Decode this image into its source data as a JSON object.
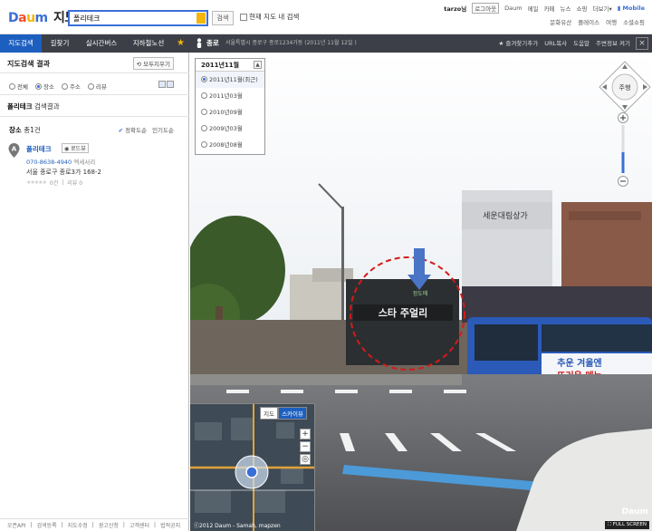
{
  "header": {
    "logo": "Daum",
    "logo_service": "지도",
    "search_value": "폴리테크",
    "search_button": "검색",
    "in_map_search": "현재 지도 내 검색",
    "user": "tarzo님",
    "logout": "로그아웃",
    "links": [
      "Daum",
      "메일",
      "카페",
      "뉴스",
      "쇼핑",
      "더보기"
    ],
    "mobile": "Mobile",
    "services": [
      "문화유산",
      "플레이스",
      "여행",
      "소셜쇼핑"
    ]
  },
  "nav": {
    "tabs": [
      "지도검색",
      "길찾기",
      "실시간버스",
      "지하철노선"
    ],
    "roadview_label": "종로",
    "roadview_address": "서울특별시 종로구 종로1234가동 (2011년 11월 12일 )",
    "right_links": [
      "즐겨찾기추가",
      "URL복사",
      "도움말",
      "주변정보 켜기"
    ],
    "close": "×"
  },
  "left": {
    "header": "지도검색 결과",
    "reset": "모두지우기",
    "filters": [
      "전체",
      "장소",
      "주소",
      "리뷰"
    ],
    "result_term": "폴리테크",
    "result_suffix": " 검색결과",
    "place_label": "장소",
    "place_count": "총1건",
    "sort_accuracy": "정확도순",
    "sort_popular": "인기도순",
    "item": {
      "marker": "A",
      "name": "폴리테크",
      "roadview": "로드뷰",
      "phone": "070-8638-4940",
      "phone_tag": "엑세서리",
      "address": "서울 종로구 종로3가 168-2",
      "rating": "0건",
      "reviews": "리뷰 0"
    },
    "footer": [
      "오픈API",
      "검색등록",
      "지도수정",
      "광고신청",
      "고객센터",
      "법적공지"
    ]
  },
  "roadview": {
    "date_header": "2011년11월",
    "dates": [
      "2011년11월(최근)",
      "2011년03월",
      "2010년09월",
      "2009년03월",
      "2008년08월"
    ],
    "compass_label": "주행",
    "store_sign": "스타 주얼리",
    "store_sign_sub": "정도매",
    "building_sign": "세운대림상가",
    "bus_ad_line1": "추운 겨울엔",
    "bus_ad_line2": "뜨거운 메뉴",
    "minimap_tabs": [
      "지도",
      "스카이뷰"
    ],
    "minimap_copyright": "ⓒ2012 Daum - Samah, mapzen",
    "watermark": "Daum",
    "full_button": "FULL SCREEN"
  }
}
